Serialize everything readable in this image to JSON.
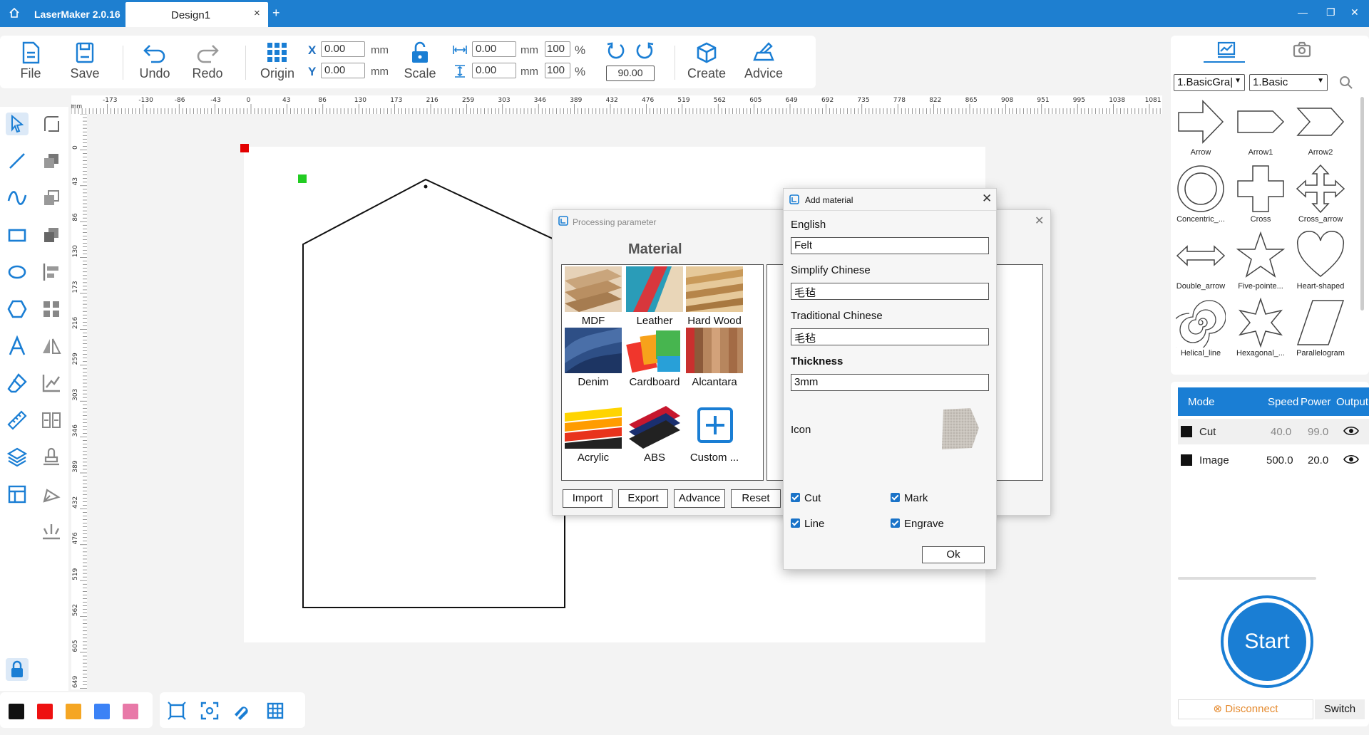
{
  "titlebar": {
    "app": "LaserMaker 2.0.16",
    "doc_tab": "Design1",
    "close": "×",
    "add": "+",
    "minimize": "—",
    "restore": "❐",
    "close_window": "✕"
  },
  "toolbar": {
    "file": "File",
    "save": "Save",
    "undo": "Undo",
    "redo": "Redo",
    "origin": "Origin",
    "scale": "Scale",
    "create": "Create",
    "advice": "Advice",
    "x_label": "X",
    "y_label": "Y",
    "x_value": "0.00",
    "y_value": "0.00",
    "unit": "mm",
    "w_value": "0.00",
    "h_value": "0.00",
    "w_pct": "100",
    "h_pct": "100",
    "pct": "%",
    "rotate": "90.00"
  },
  "ruler": {
    "unit": "mm",
    "h_ticks": [
      "-173",
      "-130",
      "-86",
      "-43",
      "0",
      "43",
      "86",
      "130",
      "173",
      "216",
      "259",
      "303",
      "346",
      "389",
      "432",
      "476",
      "519",
      "562",
      "605",
      "649",
      "692",
      "735",
      "778",
      "822",
      "865",
      "908",
      "951",
      "995",
      "1038",
      "1081"
    ],
    "v_ticks": [
      "0",
      "43",
      "86",
      "130",
      "173",
      "216",
      "259",
      "303",
      "346",
      "389",
      "432",
      "476",
      "519",
      "562",
      "605",
      "649"
    ]
  },
  "colors": {
    "accent": "#1a7ed4",
    "titlebar": "#1e7fd0",
    "swatches": [
      "#111111",
      "#ee1111",
      "#f5a623",
      "#3b82f6",
      "#e879a8"
    ]
  },
  "shapes": {
    "category": "1.BasicGra|",
    "subcategory": "1.Basic",
    "items": [
      "Arrow",
      "Arrow1",
      "Arrow2",
      "Concentric_...",
      "Cross",
      "Cross_arrow",
      "Double_arrow",
      "Five-pointe...",
      "Heart-shaped",
      "Helical_line",
      "Hexagonal_...",
      "Parallelogram"
    ]
  },
  "layers": {
    "headers": [
      "Mode",
      "Speed",
      "Power",
      "Output"
    ],
    "rows": [
      {
        "name": "Cut",
        "speed": "40.0",
        "power": "99.0",
        "color": "#111111"
      },
      {
        "name": "Image",
        "speed": "500.0",
        "power": "20.0",
        "color": "#111111"
      }
    ],
    "start": "Start",
    "disconnect": "Disconnect",
    "switch": "Switch"
  },
  "processing": {
    "title": "Processing parameter",
    "material_title": "Material",
    "materials": [
      "MDF",
      "Leather",
      "Hard Wood",
      "Denim",
      "Cardboard",
      "Alcantara",
      "Acrylic",
      "ABS",
      "Custom ..."
    ],
    "buttons": [
      "Import",
      "Export",
      "Advance",
      "Reset"
    ]
  },
  "add_material": {
    "title": "Add material",
    "english_label": "English",
    "english_value": "Felt",
    "simplified_label": "Simplify Chinese",
    "simplified_value": "毛毡",
    "traditional_label": "Traditional Chinese",
    "traditional_value": "毛毡",
    "thickness_label": "Thickness",
    "thickness_value": "3mm",
    "icon_label": "Icon",
    "checks": [
      "Cut",
      "Mark",
      "Line",
      "Engrave"
    ],
    "ok": "Ok"
  }
}
